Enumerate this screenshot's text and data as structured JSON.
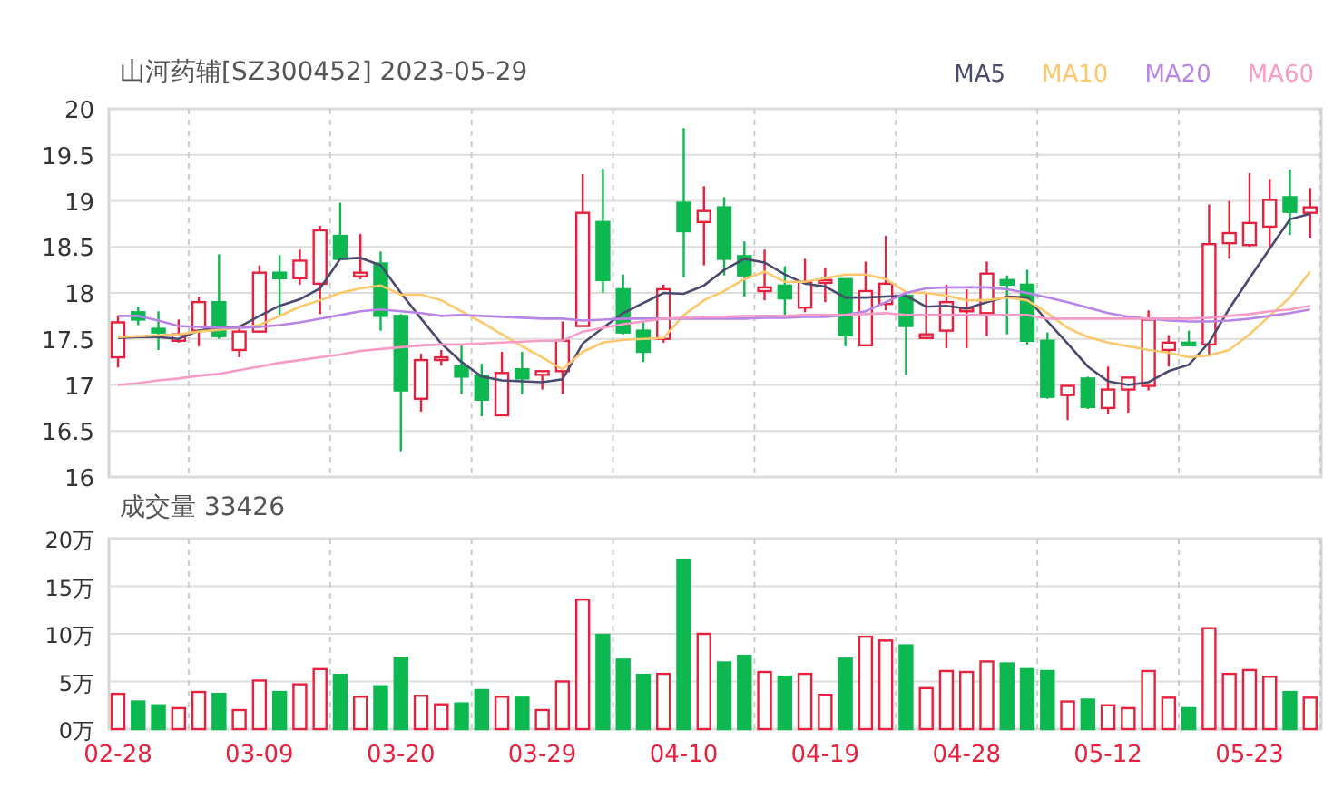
{
  "price_chart": {
    "chart_data": {
      "type": "candlestick",
      "title": "山河药辅[SZ300452] 2023-05-29",
      "grid": true,
      "ylim": [
        16,
        20
      ],
      "yticks": [
        16,
        16.5,
        17,
        17.5,
        18,
        18.5,
        19,
        19.5,
        20
      ],
      "series": [
        {
          "name": "MA5",
          "type": "line",
          "color": "#4a4a6e",
          "values": [
            17.51,
            17.52,
            17.52,
            17.5,
            17.59,
            17.62,
            17.63,
            17.75,
            17.86,
            17.93,
            18.05,
            18.37,
            18.38,
            18.3,
            18.0,
            17.72,
            17.45,
            17.25,
            17.09,
            17.05,
            17.04,
            17.03,
            17.06,
            17.45,
            17.62,
            17.78,
            17.89,
            18.0,
            17.99,
            18.08,
            18.25,
            18.37,
            18.33,
            18.2,
            18.1,
            18.07,
            17.95,
            17.95,
            17.96,
            17.97,
            17.85,
            17.86,
            17.83,
            17.9,
            17.96,
            17.95,
            17.69,
            17.45,
            17.2,
            17.04,
            17.0,
            17.03,
            17.15,
            17.22,
            17.46,
            17.83,
            18.16,
            18.48,
            18.8,
            18.86
          ]
        },
        {
          "name": "MA10",
          "type": "line",
          "color": "#fdc76b",
          "values": [
            17.52,
            17.53,
            17.54,
            17.55,
            17.58,
            17.6,
            17.62,
            17.65,
            17.75,
            17.85,
            17.92,
            18.0,
            18.05,
            18.08,
            17.98,
            17.98,
            17.92,
            17.8,
            17.68,
            17.55,
            17.42,
            17.3,
            17.17,
            17.36,
            17.46,
            17.49,
            17.5,
            17.51,
            17.76,
            17.92,
            18.02,
            18.15,
            18.23,
            18.12,
            18.12,
            18.16,
            18.2,
            18.2,
            18.15,
            18.01,
            18.0,
            17.97,
            17.92,
            17.92,
            17.95,
            17.92,
            17.78,
            17.62,
            17.52,
            17.46,
            17.42,
            17.38,
            17.35,
            17.3,
            17.32,
            17.38,
            17.55,
            17.75,
            17.95,
            18.23
          ]
        },
        {
          "name": "MA20",
          "type": "line",
          "color": "#b884e8",
          "values": [
            17.75,
            17.75,
            17.7,
            17.64,
            17.63,
            17.62,
            17.62,
            17.63,
            17.65,
            17.68,
            17.72,
            17.76,
            17.8,
            17.82,
            17.8,
            17.78,
            17.75,
            17.76,
            17.75,
            17.74,
            17.73,
            17.72,
            17.72,
            17.7,
            17.71,
            17.72,
            17.72,
            17.72,
            17.72,
            17.72,
            17.72,
            17.72,
            17.73,
            17.73,
            17.74,
            17.74,
            17.76,
            17.8,
            17.9,
            18.0,
            18.05,
            18.06,
            18.06,
            18.06,
            18.04,
            18.0,
            17.95,
            17.9,
            17.84,
            17.78,
            17.74,
            17.72,
            17.7,
            17.69,
            17.69,
            17.7,
            17.72,
            17.75,
            17.78,
            17.82
          ]
        },
        {
          "name": "MA60",
          "type": "line",
          "color": "#f89bc7",
          "values": [
            17.0,
            17.02,
            17.05,
            17.07,
            17.1,
            17.12,
            17.16,
            17.2,
            17.24,
            17.27,
            17.3,
            17.33,
            17.37,
            17.39,
            17.41,
            17.43,
            17.44,
            17.44,
            17.45,
            17.46,
            17.47,
            17.48,
            17.48,
            17.58,
            17.62,
            17.66,
            17.69,
            17.72,
            17.73,
            17.74,
            17.74,
            17.75,
            17.75,
            17.75,
            17.76,
            17.76,
            17.76,
            17.77,
            17.78,
            17.76,
            17.76,
            17.76,
            17.76,
            17.76,
            17.76,
            17.76,
            17.72,
            17.72,
            17.72,
            17.72,
            17.72,
            17.72,
            17.72,
            17.72,
            17.73,
            17.75,
            17.77,
            17.8,
            17.82,
            17.86
          ]
        }
      ],
      "ohlc": [
        [
          17.3,
          17.75,
          17.19,
          17.68
        ],
        [
          17.79,
          17.85,
          17.65,
          17.71
        ],
        [
          17.61,
          17.8,
          17.38,
          17.57
        ],
        [
          17.48,
          17.71,
          17.46,
          17.55
        ],
        [
          17.59,
          17.96,
          17.42,
          17.9
        ],
        [
          17.9,
          18.42,
          17.5,
          17.53
        ],
        [
          17.38,
          17.65,
          17.3,
          17.58
        ],
        [
          17.58,
          18.3,
          17.58,
          18.22
        ],
        [
          18.22,
          18.41,
          17.74,
          18.16
        ],
        [
          18.16,
          18.47,
          18.09,
          18.35
        ],
        [
          18.1,
          18.73,
          17.77,
          18.68
        ],
        [
          18.62,
          18.98,
          18.37,
          18.37
        ],
        [
          18.18,
          18.64,
          18.15,
          18.22
        ],
        [
          18.32,
          18.45,
          17.59,
          17.75
        ],
        [
          17.75,
          17.77,
          16.28,
          16.94
        ],
        [
          16.85,
          17.34,
          16.71,
          17.27
        ],
        [
          17.28,
          17.38,
          17.21,
          17.3
        ],
        [
          17.2,
          17.43,
          16.9,
          17.09
        ],
        [
          17.1,
          17.23,
          16.66,
          16.84
        ],
        [
          16.67,
          17.36,
          16.67,
          17.13
        ],
        [
          17.17,
          17.36,
          16.9,
          17.07
        ],
        [
          17.11,
          17.15,
          16.95,
          17.15
        ],
        [
          17.15,
          17.69,
          16.9,
          17.48
        ],
        [
          17.64,
          19.29,
          17.64,
          18.87
        ],
        [
          18.77,
          19.35,
          18.0,
          18.14
        ],
        [
          18.04,
          18.2,
          17.55,
          17.57
        ],
        [
          17.59,
          17.69,
          17.25,
          17.36
        ],
        [
          17.5,
          18.09,
          17.46,
          18.04
        ],
        [
          18.98,
          19.79,
          18.17,
          18.67
        ],
        [
          18.77,
          19.16,
          18.3,
          18.89
        ],
        [
          18.93,
          19.04,
          18.19,
          18.37
        ],
        [
          18.4,
          18.56,
          17.96,
          18.19
        ],
        [
          18.02,
          18.47,
          17.92,
          18.06
        ],
        [
          18.08,
          18.29,
          17.75,
          17.94
        ],
        [
          17.84,
          18.37,
          17.79,
          18.12
        ],
        [
          18.12,
          18.27,
          17.9,
          18.14
        ],
        [
          18.15,
          18.15,
          17.42,
          17.54
        ],
        [
          17.43,
          18.34,
          17.43,
          18.02
        ],
        [
          17.88,
          18.62,
          17.81,
          18.1
        ],
        [
          17.97,
          18.02,
          17.11,
          17.64
        ],
        [
          17.51,
          18.01,
          17.5,
          17.55
        ],
        [
          17.59,
          18.09,
          17.4,
          17.9
        ],
        [
          17.81,
          18.04,
          17.4,
          17.83
        ],
        [
          17.78,
          18.34,
          17.53,
          18.21
        ],
        [
          18.14,
          18.19,
          17.55,
          18.09
        ],
        [
          18.09,
          18.25,
          17.44,
          17.48
        ],
        [
          17.48,
          17.57,
          16.85,
          16.87
        ],
        [
          16.89,
          16.99,
          16.62,
          16.99
        ],
        [
          17.07,
          17.09,
          16.74,
          16.76
        ],
        [
          16.75,
          17.2,
          16.69,
          16.95
        ],
        [
          16.95,
          17.08,
          16.7,
          17.08
        ],
        [
          16.99,
          17.81,
          16.94,
          17.71
        ],
        [
          17.38,
          17.54,
          17.2,
          17.46
        ],
        [
          17.46,
          17.59,
          17.43,
          17.44
        ],
        [
          17.44,
          18.96,
          17.33,
          18.53
        ],
        [
          18.54,
          19.0,
          18.37,
          18.65
        ],
        [
          18.52,
          19.3,
          18.5,
          18.76
        ],
        [
          18.72,
          19.24,
          18.5,
          19.01
        ],
        [
          19.04,
          19.34,
          18.63,
          18.88
        ],
        [
          18.87,
          19.14,
          18.6,
          18.93
        ]
      ]
    }
  },
  "volume_chart": {
    "chart_data": {
      "type": "bar",
      "stacked": true,
      "grid": true,
      "title": "成交量 33426",
      "ylim": [
        0,
        20
      ],
      "categories": [
        "02-28",
        null,
        null,
        null,
        null,
        null,
        null,
        "03-09",
        null,
        null,
        null,
        null,
        null,
        null,
        "03-20",
        null,
        null,
        null,
        null,
        null,
        null,
        "03-29",
        null,
        null,
        null,
        null,
        null,
        null,
        "04-10",
        null,
        null,
        null,
        null,
        null,
        null,
        "04-19",
        null,
        null,
        null,
        null,
        null,
        null,
        "04-28",
        null,
        null,
        null,
        null,
        null,
        null,
        "05-12",
        null,
        null,
        null,
        null,
        null,
        null,
        "05-23",
        null,
        null,
        null
      ],
      "yticks": [
        {
          "value": 0,
          "label": "0万"
        },
        {
          "value": 5,
          "label": "5万"
        },
        {
          "value": 10,
          "label": "10万"
        },
        {
          "value": 15,
          "label": "15万"
        },
        {
          "value": 20,
          "label": "20万"
        }
      ],
      "series": [
        {
          "color": "#e8203d",
          "values": [
            3.7,
            null,
            null,
            2.2,
            3.9,
            null,
            2.0,
            5.1,
            null,
            4.7,
            6.3,
            null,
            3.4,
            null,
            null,
            3.5,
            2.6,
            null,
            null,
            3.4,
            null,
            2.0,
            5.0,
            13.6,
            null,
            null,
            null,
            5.8,
            null,
            10.0,
            null,
            null,
            6.0,
            null,
            5.8,
            3.6,
            null,
            9.7,
            9.3,
            null,
            4.3,
            6.1,
            6.0,
            7.1,
            null,
            null,
            null,
            2.9,
            null,
            2.5,
            2.2,
            6.1,
            3.3,
            null,
            10.6,
            5.8,
            6.2,
            5.5,
            null,
            3.3
          ]
        },
        {
          "color": "#0cb84f",
          "values": [
            null,
            2.9,
            2.5,
            null,
            null,
            3.7,
            null,
            null,
            3.9,
            null,
            null,
            5.7,
            null,
            4.5,
            7.5,
            null,
            null,
            2.7,
            4.1,
            null,
            3.3,
            null,
            null,
            null,
            9.9,
            7.3,
            5.7,
            null,
            17.8,
            null,
            7.0,
            7.7,
            null,
            5.5,
            null,
            null,
            7.4,
            null,
            null,
            8.8,
            null,
            null,
            null,
            null,
            6.9,
            6.3,
            6.1,
            null,
            3.1,
            null,
            null,
            null,
            null,
            2.2,
            null,
            null,
            null,
            null,
            3.9,
            null
          ]
        }
      ]
    }
  }
}
